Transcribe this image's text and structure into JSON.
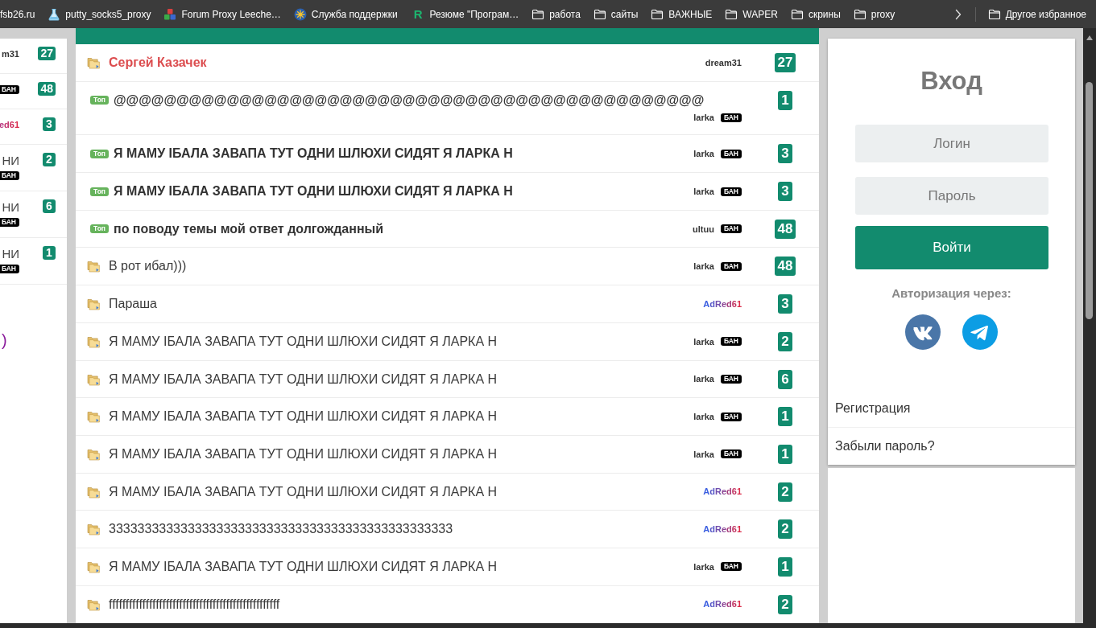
{
  "bookmarks": [
    {
      "label": "fsb26.ru"
    },
    {
      "label": "putty_socks5_proxy",
      "kind": "flask"
    },
    {
      "label": "Forum Proxy Leeche…",
      "kind": "cubes"
    },
    {
      "label": "Служба поддержки",
      "kind": "emblem"
    },
    {
      "label": "Резюме \"Програм…",
      "kind": "letter",
      "letter": "R"
    },
    {
      "label": "работа",
      "kind": "folder"
    },
    {
      "label": "сайты",
      "kind": "folder"
    },
    {
      "label": "ВАЖНЫЕ",
      "kind": "folder"
    },
    {
      "label": "WAPER",
      "kind": "folder"
    },
    {
      "label": "скрины",
      "kind": "folder"
    },
    {
      "label": "proxy",
      "kind": "folder"
    }
  ],
  "other_bookmarks": {
    "label": "Другое избранное",
    "kind": "folder"
  },
  "left_panel": {
    "rows": [
      {
        "author": {
          "name": "m31",
          "kind": "plain"
        },
        "count": "27"
      },
      {
        "author": {
          "badge": "БАН"
        },
        "count": "48"
      },
      {
        "author": {
          "name": "ed61",
          "kind": "gradient"
        },
        "count": "3"
      },
      {
        "title": "НИ",
        "author": {
          "badge": "БАН"
        },
        "count": "2"
      },
      {
        "title": "НИ",
        "author": {
          "badge": "БАН"
        },
        "count": "6"
      },
      {
        "title": "НИ",
        "author": {
          "badge": "БАН"
        },
        "count": "1"
      }
    ],
    "footer": ")"
  },
  "topics": [
    {
      "kind": "highlighted",
      "title": "Сергей Казачек",
      "author": {
        "name": "dream31",
        "kind": "plain"
      },
      "count": "27"
    },
    {
      "kind": "pinned",
      "tag": "Топ",
      "title": "@@@@@@@@@@@@@@@@@@@@@@@@@@@@@@@@@@@@@@@@@@@@@@@",
      "author": {
        "name": "larka",
        "kind": "plain",
        "badge": "БАН"
      },
      "count": "1"
    },
    {
      "kind": "pinned",
      "tag": "Топ",
      "title": "Я МАМУ ІБАЛА ЗАВАПА ТУТ ОДНИ ШЛЮХИ СИДЯТ Я ЛАРКА Н",
      "author": {
        "name": "larka",
        "kind": "plain",
        "badge": "БАН"
      },
      "count": "3"
    },
    {
      "kind": "pinned",
      "tag": "Топ",
      "title": "Я МАМУ ІБАЛА ЗАВАПА ТУТ ОДНИ ШЛЮХИ СИДЯТ Я ЛАРКА Н",
      "author": {
        "name": "larka",
        "kind": "plain",
        "badge": "БАН"
      },
      "count": "3"
    },
    {
      "kind": "pinned",
      "tag": "Топ",
      "title": "по поводу темы мой ответ долгожданный",
      "author": {
        "name": "ultuu",
        "kind": "plain",
        "badge": "БАН"
      },
      "count": "48"
    },
    {
      "kind": "normal",
      "title": "В рот ибал)))",
      "author": {
        "name": "larka",
        "kind": "plain",
        "badge": "БАН"
      },
      "count": "48"
    },
    {
      "kind": "normal",
      "title": "Параша",
      "author": {
        "name": "AdRed61",
        "kind": "gradient"
      },
      "count": "3"
    },
    {
      "kind": "normal",
      "title": "Я МАМУ ІБАЛА ЗАВАПА ТУТ ОДНИ ШЛЮХИ СИДЯТ Я ЛАРКА Н",
      "author": {
        "name": "larka",
        "kind": "plain",
        "badge": "БАН"
      },
      "count": "2"
    },
    {
      "kind": "normal",
      "title": "Я МАМУ ІБАЛА ЗАВАПА ТУТ ОДНИ ШЛЮХИ СИДЯТ Я ЛАРКА Н",
      "author": {
        "name": "larka",
        "kind": "plain",
        "badge": "БАН"
      },
      "count": "6"
    },
    {
      "kind": "normal",
      "title": "Я МАМУ ІБАЛА ЗАВАПА ТУТ ОДНИ ШЛЮХИ СИДЯТ Я ЛАРКА Н",
      "author": {
        "name": "larka",
        "kind": "plain",
        "badge": "БАН"
      },
      "count": "1"
    },
    {
      "kind": "normal",
      "title": "Я МАМУ ІБАЛА ЗАВАПА ТУТ ОДНИ ШЛЮХИ СИДЯТ Я ЛАРКА Н",
      "author": {
        "name": "larka",
        "kind": "plain",
        "badge": "БАН"
      },
      "count": "1"
    },
    {
      "kind": "normal",
      "title": "Я МАМУ ІБАЛА ЗАВАПА ТУТ ОДНИ ШЛЮХИ СИДЯТ Я ЛАРКА Н",
      "author": {
        "name": "AdRed61",
        "kind": "gradient"
      },
      "count": "2"
    },
    {
      "kind": "normal",
      "title": "333333333333333333333333333333333333333333333333",
      "author": {
        "name": "AdRed61",
        "kind": "gradient"
      },
      "count": "2"
    },
    {
      "kind": "normal",
      "title": "Я МАМУ ІБАЛА ЗАВАПА ТУТ ОДНИ ШЛЮХИ СИДЯТ Я ЛАРКА Н",
      "author": {
        "name": "larka",
        "kind": "plain",
        "badge": "БАН"
      },
      "count": "1"
    },
    {
      "kind": "normal",
      "title": "fffffffffffffffffffffffffffffffffffffffffffffffffff",
      "author": {
        "name": "AdRed61",
        "kind": "gradient"
      },
      "count": "2"
    }
  ],
  "login": {
    "title": "Вход",
    "fields": [
      {
        "placeholder": "Логин"
      },
      {
        "placeholder": "Пароль"
      }
    ],
    "button": "Войти",
    "social_label": "Авторизация через:",
    "social": [
      {
        "kind": "vk"
      },
      {
        "kind": "telegram"
      }
    ],
    "links": [
      "Регистрация",
      "Забыли пароль?"
    ]
  }
}
